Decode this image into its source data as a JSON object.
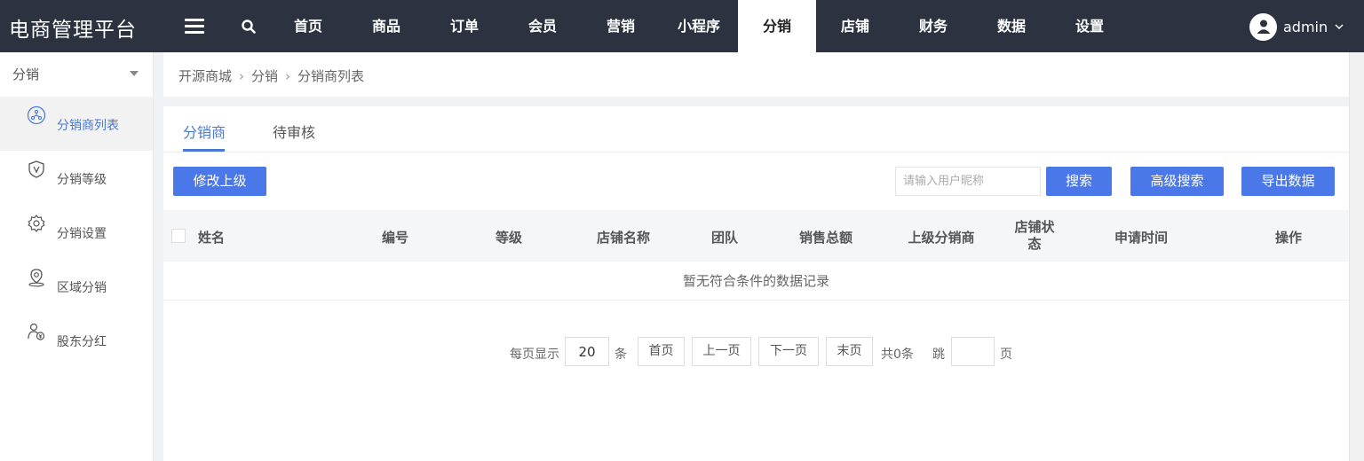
{
  "header": {
    "brand": "电商管理平台",
    "nav": [
      {
        "label": "首页"
      },
      {
        "label": "商品"
      },
      {
        "label": "订单"
      },
      {
        "label": "会员"
      },
      {
        "label": "营销"
      },
      {
        "label": "小程序"
      },
      {
        "label": "分销",
        "active": true
      },
      {
        "label": "店铺"
      },
      {
        "label": "财务"
      },
      {
        "label": "数据"
      },
      {
        "label": "设置"
      }
    ],
    "user": {
      "name": "admin"
    }
  },
  "sidebar": {
    "heading": "分销",
    "items": [
      {
        "label": "分销商列表",
        "icon": "network-icon",
        "active": true
      },
      {
        "label": "分销等级",
        "icon": "shield-v-icon"
      },
      {
        "label": "分销设置",
        "icon": "gear-icon"
      },
      {
        "label": "区域分销",
        "icon": "location-pin-icon"
      },
      {
        "label": "股东分红",
        "icon": "users-coin-icon"
      }
    ]
  },
  "breadcrumb": [
    "开源商城",
    "分销",
    "分销商列表"
  ],
  "tabs": [
    {
      "label": "分销商",
      "active": true
    },
    {
      "label": "待审核"
    }
  ],
  "toolbar": {
    "edit_parent_label": "修改上级",
    "search_placeholder": "请输入用户昵称",
    "search_value": "",
    "search_label": "搜索",
    "advanced_search_label": "高级搜索",
    "export_label": "导出数据"
  },
  "table": {
    "columns": [
      "姓名",
      "编号",
      "等级",
      "店铺名称",
      "团队",
      "销售总额",
      "上级分销商",
      "店铺状态",
      "申请时间",
      "操作"
    ],
    "empty_text": "暂无符合条件的数据记录"
  },
  "pagination": {
    "per_page_label": "每页显示",
    "per_page_value": "20",
    "unit_label": "条",
    "first_label": "首页",
    "prev_label": "上一页",
    "next_label": "下一页",
    "last_label": "末页",
    "total_label": "共0条",
    "jump_label": "跳",
    "page_unit": "页",
    "jump_value": ""
  },
  "colors": {
    "topbar": "#2d3240",
    "accent": "#4a78e8",
    "active_text": "#4a78d8"
  }
}
